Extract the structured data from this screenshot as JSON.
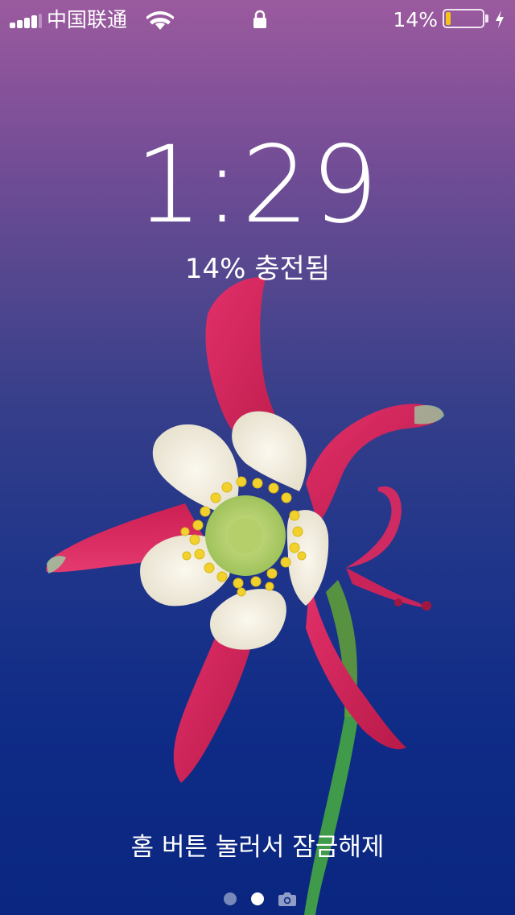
{
  "status_bar": {
    "carrier": "中国联通",
    "battery_percent_text": "14%",
    "battery_level": 0.14,
    "signal_bars_filled": 4,
    "signal_bars_total": 5,
    "icons": [
      "signal-bars-icon",
      "wifi-icon",
      "lock-icon",
      "battery-icon",
      "charging-bolt-icon"
    ]
  },
  "lock_screen": {
    "time": "1:29",
    "charge_status": "14% 충전됨",
    "unlock_hint": "홈 버튼 눌러서 잠금해제"
  },
  "page_indicator": {
    "pages": 2,
    "current_page": 2,
    "trailing_icon": "camera-icon"
  },
  "colors": {
    "battery_fill": "#f5c419",
    "background_top": "#9b5a9e",
    "background_bottom": "#0a2680",
    "petal_red": "#d8245a",
    "petal_cream": "#f4efe2",
    "stamen_yellow": "#f2d22a",
    "stem_green": "#3f9a4a"
  }
}
